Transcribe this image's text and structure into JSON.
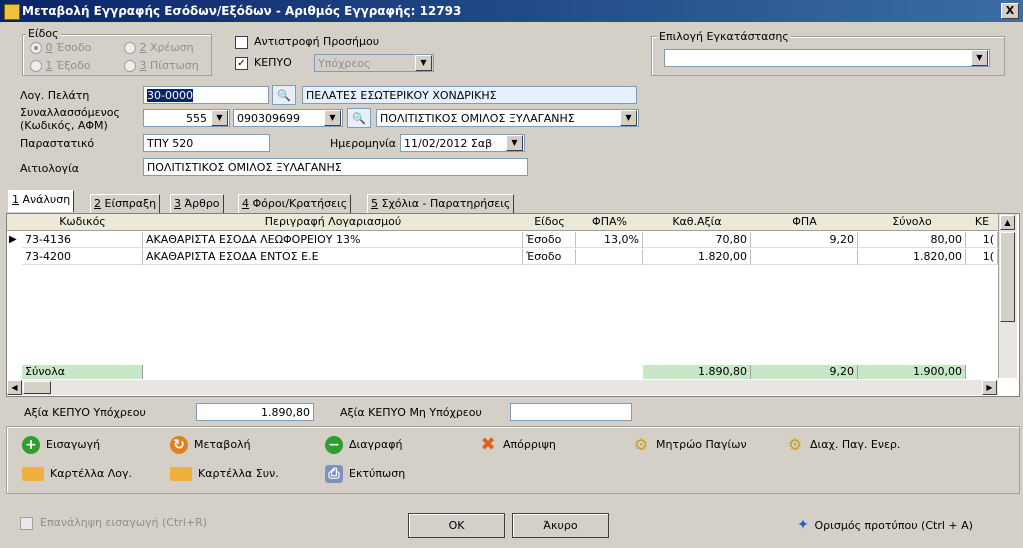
{
  "window": {
    "title": "Μεταβολή Εγγραφής Εσόδων/Εξόδων - Αριθμός Εγγραφής: 12793",
    "close": "X"
  },
  "eidos": {
    "label": "Είδος",
    "options": [
      {
        "num": "0",
        "label": "Έσοδο"
      },
      {
        "num": "2",
        "label": "Χρέωση"
      },
      {
        "num": "1",
        "label": "Έξοδο"
      },
      {
        "num": "3",
        "label": "Πίστωση"
      }
    ]
  },
  "antistrofi": {
    "label": "Αντιστροφή Προσήμου"
  },
  "kepyo": {
    "label": "ΚΕΠΥΟ",
    "value": "Υπόχρεος"
  },
  "egkatastasi": {
    "label": "Επιλογή Εγκατάστασης",
    "value": ""
  },
  "form": {
    "log_pelati_label": "Λογ. Πελάτη",
    "log_pelati_value": "30-0000",
    "log_pelati_desc": "ΠΕΛΑΤΕΣ ΕΣΩΤΕΡΙΚΟΥ ΧΟΝΔΡΙΚΗΣ",
    "synallassomenos_label1": "Συναλλασσόμενος",
    "synallassomenos_label2": "(Κωδικός, ΑΦΜ)",
    "synallassomenos_code": "555",
    "synallassomenos_afm": "090309699",
    "synallassomenos_name": "ΠΟΛΙΤΙΣΤΙΚΟΣ ΟΜΙΛΟΣ ΞΥΛΑΓΑΝΗΣ",
    "parastatiko_label": "Παραστατικό",
    "parastatiko_value": "ΤΠΥ 520",
    "imerominia_label": "Ημερομηνία",
    "imerominia_value": "11/02/2012 Σαβ",
    "aitiologia_label": "Αιτιολογία",
    "aitiologia_value": "ΠΟΛΙΤΙΣΤΙΚΟΣ ΟΜΙΛΟΣ ΞΥΛΑΓΑΝΗΣ"
  },
  "tabs": [
    {
      "num": "1",
      "label": "Ανάλυση"
    },
    {
      "num": "2",
      "label": "Είσπραξη"
    },
    {
      "num": "3",
      "label": "Άρθρο"
    },
    {
      "num": "4",
      "label": "Φόροι/Κρατήσεις"
    },
    {
      "num": "5",
      "label": "Σχόλια - Παρατηρήσεις"
    }
  ],
  "grid": {
    "headers": [
      "Κωδικός",
      "Περιγραφή Λογαριασμού",
      "Είδος",
      "ΦΠΑ%",
      "Καθ.Αξία",
      "ΦΠΑ",
      "Σύνολο",
      "ΚΕ"
    ],
    "rows": [
      {
        "code": "73-4136",
        "desc": "ΑΚΑΘΑΡΙΣΤΑ ΕΣΟΔΑ ΛΕΩΦΟΡΕΙΟΥ 13%",
        "eidos": "Έσοδο",
        "fpa_pct": "13,0%",
        "kath": "70,80",
        "fpa": "9,20",
        "synolo": "80,00",
        "ke": "1("
      },
      {
        "code": "73-4200",
        "desc": "ΑΚΑΘΑΡΙΣΤΑ ΕΣΟΔΑ ΕΝΤΟΣ Ε.Ε",
        "eidos": "Έσοδο",
        "fpa_pct": "",
        "kath": "1.820,00",
        "fpa": "",
        "synolo": "1.820,00",
        "ke": "1("
      }
    ],
    "totals": {
      "label": "Σύνολα",
      "kath": "1.890,80",
      "fpa": "9,20",
      "synolo": "1.900,00"
    }
  },
  "kepyo_values": {
    "ypoxreou_label": "Αξία ΚΕΠΥΟ Υπόχρεου",
    "ypoxreou_value": "1.890,80",
    "mi_ypoxreou_label": "Αξία ΚΕΠΥΟ Μη Υπόχρεου",
    "mi_ypoxreou_value": ""
  },
  "actions": {
    "eisagogi": "Εισαγωγή",
    "metavoli": "Μεταβολή",
    "diagrafi": "Διαγραφή",
    "aporripsi": "Απόρριψη",
    "mitroo": "Μητρώο Παγίων",
    "diax": "Διαχ. Παγ. Ενερ.",
    "kartella_log": "Καρτέλλα Λογ.",
    "kartella_syn": "Καρτέλλα Συν.",
    "ektyposi": "Εκτύπωση"
  },
  "footer": {
    "epanalipsi": "Επανάληψη εισαγωγή (Ctrl+R)",
    "ok": "OK",
    "akyro": "Άκυρο",
    "protypo": "Ορισμός προτύπου (Ctrl + A)"
  }
}
